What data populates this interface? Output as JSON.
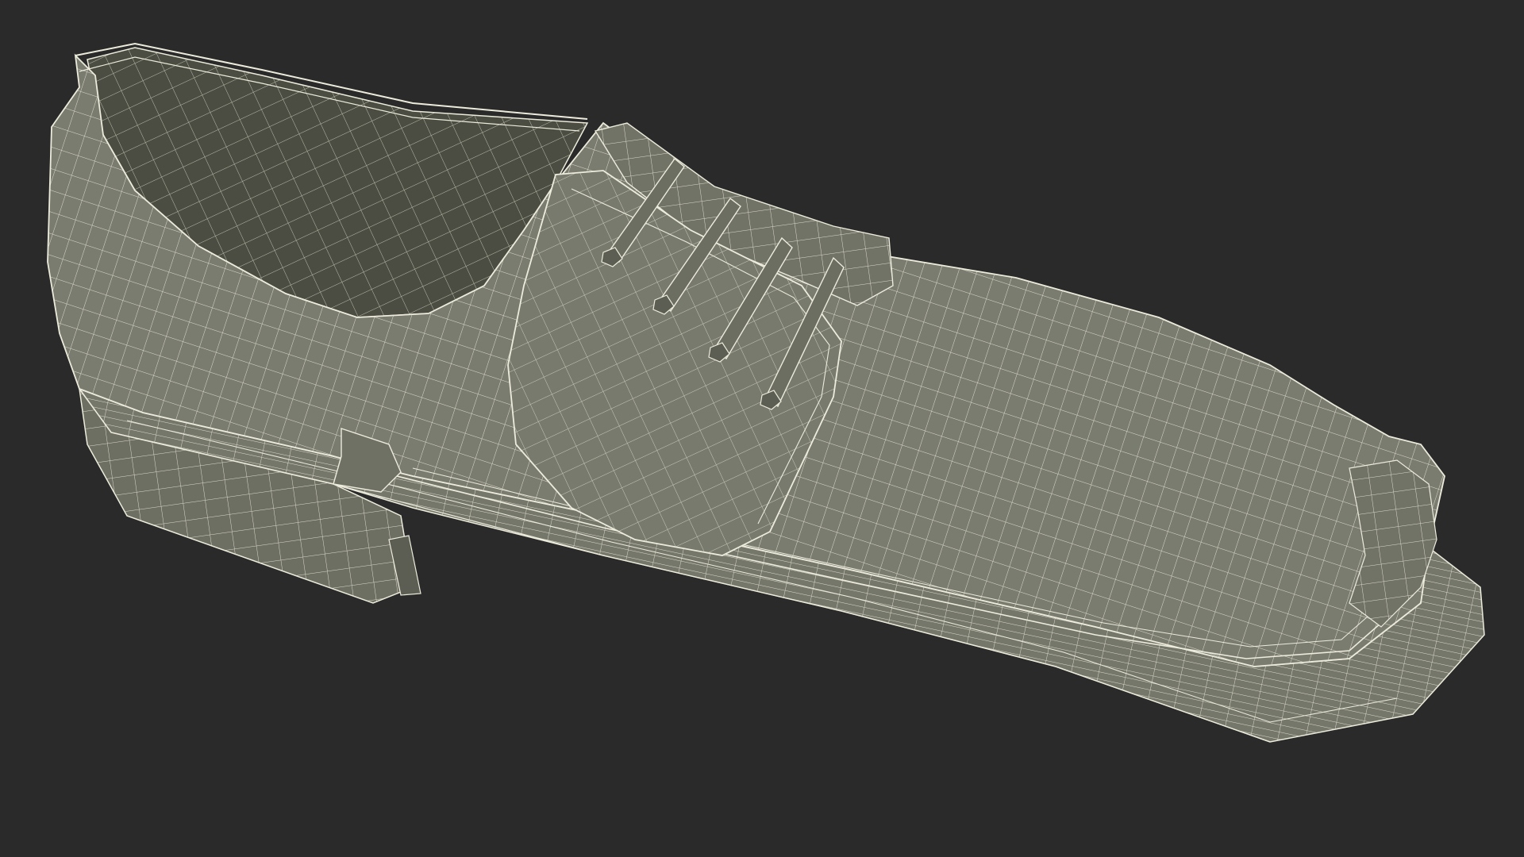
{
  "scene": {
    "subject": "wireframe-shoe-render",
    "colors": {
      "background": "#2a2a2a",
      "upper_fill": "#7b7c70",
      "upper_shadow": "#64655a",
      "interior_fill": "#55574b",
      "interior_dark": "#3e4036",
      "sole_fill": "#76776b",
      "sole_dark": "#5d5e53",
      "wire": "#ecebdc",
      "lace_fill": "#6d6e62"
    }
  }
}
